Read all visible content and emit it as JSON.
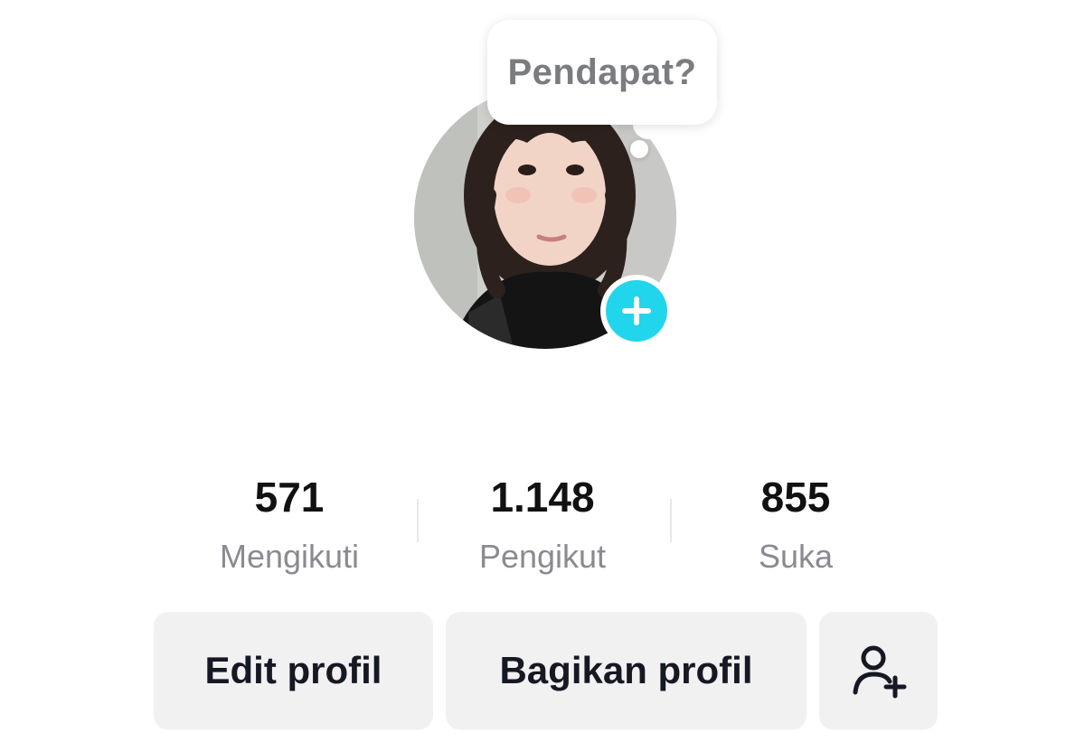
{
  "profile": {
    "note_prompt": "Pendapat?",
    "avatar_icon": "user-photo",
    "add_avatar_icon": "plus-icon",
    "accent_color": "#20d5ec"
  },
  "stats": {
    "following": {
      "value": "571",
      "label": "Mengikuti"
    },
    "followers": {
      "value": "1.148",
      "label": "Pengikut"
    },
    "likes": {
      "value": "855",
      "label": "Suka"
    }
  },
  "actions": {
    "edit_label": "Edit profil",
    "share_label": "Bagikan profil",
    "add_friend_icon": "add-friend-icon"
  }
}
